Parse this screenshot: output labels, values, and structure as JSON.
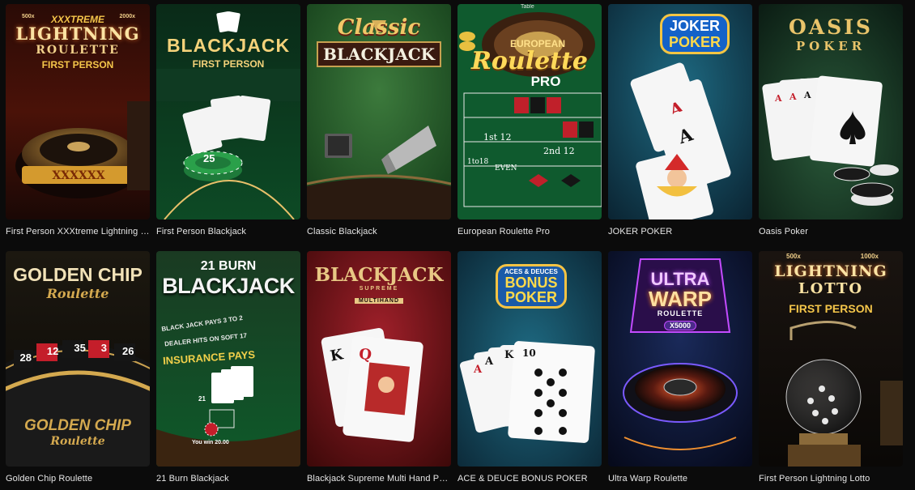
{
  "games": [
    {
      "id": "g1",
      "caption": "First Person XXXtreme Lightning Roul…",
      "logo": {
        "line1": "XXXTREME",
        "line2": "LIGHTNING",
        "line3": "ROULETTE",
        "line4": "FIRST PERSON",
        "mult_left": "500x",
        "mult_right": "2000x"
      },
      "accent": "#e8b04a"
    },
    {
      "id": "g2",
      "caption": "First Person Blackjack",
      "logo": {
        "line1": "BLACKJACK",
        "line2": "FIRST PERSON",
        "chip": "25"
      },
      "accent": "#e8c06a"
    },
    {
      "id": "g3",
      "caption": "Classic Blackjack",
      "logo": {
        "line1": "Classic",
        "line2": "BLACKJACK"
      },
      "accent": "#d9b25a"
    },
    {
      "id": "g4",
      "caption": "European Roulette Pro",
      "logo": {
        "line1": "EUROPEAN",
        "line2": "Roulette",
        "line3": "PRO",
        "table_label": "Table",
        "dozen1": "1st 12",
        "dozen2": "2nd 12",
        "low": "1to18",
        "even": "EVEN"
      },
      "accent": "#f2c94c"
    },
    {
      "id": "g5",
      "caption": "JOKER POKER",
      "logo": {
        "line1": "JOKER",
        "line2": "POKER"
      },
      "accent": "#f4c542"
    },
    {
      "id": "g6",
      "caption": "Oasis Poker",
      "logo": {
        "line1": "OASIS",
        "line2": "POKER"
      },
      "accent": "#e9c46a"
    },
    {
      "id": "g7",
      "caption": "Golden Chip Roulette",
      "logo": {
        "line1": "GOLDEN CHIP",
        "line2": "Roulette",
        "numbers": [
          "28",
          "12",
          "35",
          "3",
          "26"
        ]
      },
      "accent": "#d4a94f"
    },
    {
      "id": "g8",
      "caption": "21 Burn Blackjack",
      "logo": {
        "line1": "21 BURN",
        "line2": "BLACKJACK",
        "table1": "BLACK JACK PAYS 3 TO 2",
        "table2": "DEALER HITS ON SOFT 17",
        "table3": "INSURANCE PAYS",
        "score": "21",
        "win": "You win 20.00"
      },
      "accent": "#ffffff"
    },
    {
      "id": "g9",
      "caption": "Blackjack Supreme Multi Hand Perfec…",
      "logo": {
        "line1": "BLACKJACK",
        "line2": "SUPREME",
        "line3": "MULTIHAND"
      },
      "accent": "#e3c27a"
    },
    {
      "id": "g10",
      "caption": "ACE & DEUCE BONUS POKER",
      "logo": {
        "line1": "ACES & DEUCES",
        "line2": "BONUS",
        "line3": "POKER"
      },
      "accent": "#f6c343"
    },
    {
      "id": "g11",
      "caption": "Ultra Warp Roulette",
      "logo": {
        "line1": "ULTRA",
        "line2": "WARP",
        "line3": "ROULETTE",
        "line4": "X5000"
      },
      "accent": "#c44bff"
    },
    {
      "id": "g12",
      "caption": "First Person Lightning Lotto",
      "logo": {
        "line1": "LIGHTNING",
        "line2": "LOTTO",
        "line3": "FIRST PERSON",
        "mult_left": "500x",
        "mult_right": "1000x"
      },
      "accent": "#e8b04a"
    }
  ]
}
